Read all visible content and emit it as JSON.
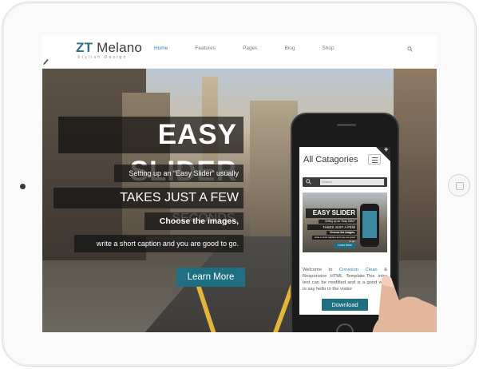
{
  "site": {
    "logo_prefix": "ZT",
    "logo_name": "Melano",
    "logo_tagline": "Stylish Design"
  },
  "nav": {
    "items": [
      {
        "label": "Home",
        "active": true
      },
      {
        "label": "Features",
        "active": false
      },
      {
        "label": "Pages",
        "active": false
      },
      {
        "label": "Blog",
        "active": false
      },
      {
        "label": "Shop",
        "active": false
      }
    ]
  },
  "hero": {
    "title": "EASY SLIDER",
    "line1": "Setting up an “Easy Slider” usually",
    "line2": "TAKES JUST A FEW SECONDS.",
    "line3": "Choose the images,",
    "line4": "write a short caption and you are good to go.",
    "cta_label": "Learn More"
  },
  "phone": {
    "title": "All Catagories",
    "plus": "+",
    "search_placeholder": "Search",
    "mini_title": "EASY SLIDER",
    "mini_line1": "Setting up an “Easy Slider” usually",
    "mini_line2": "TAKES JUST A FEW SECONDS.",
    "mini_line3": "Choose the images,",
    "mini_line4": "write a short caption and you are good to go.",
    "mini_cta": "Learn More",
    "text_before": "Welcome to ",
    "text_link": "Crevision Clean",
    "text_after": " & Responsive HTML Template.This intro text can be modified and is a good way to say hello to the visitor",
    "download_label": "Download"
  },
  "colors": {
    "accent": "#1f6f82",
    "nav_active": "#2f7fb3",
    "logo": "#2b6f88"
  }
}
